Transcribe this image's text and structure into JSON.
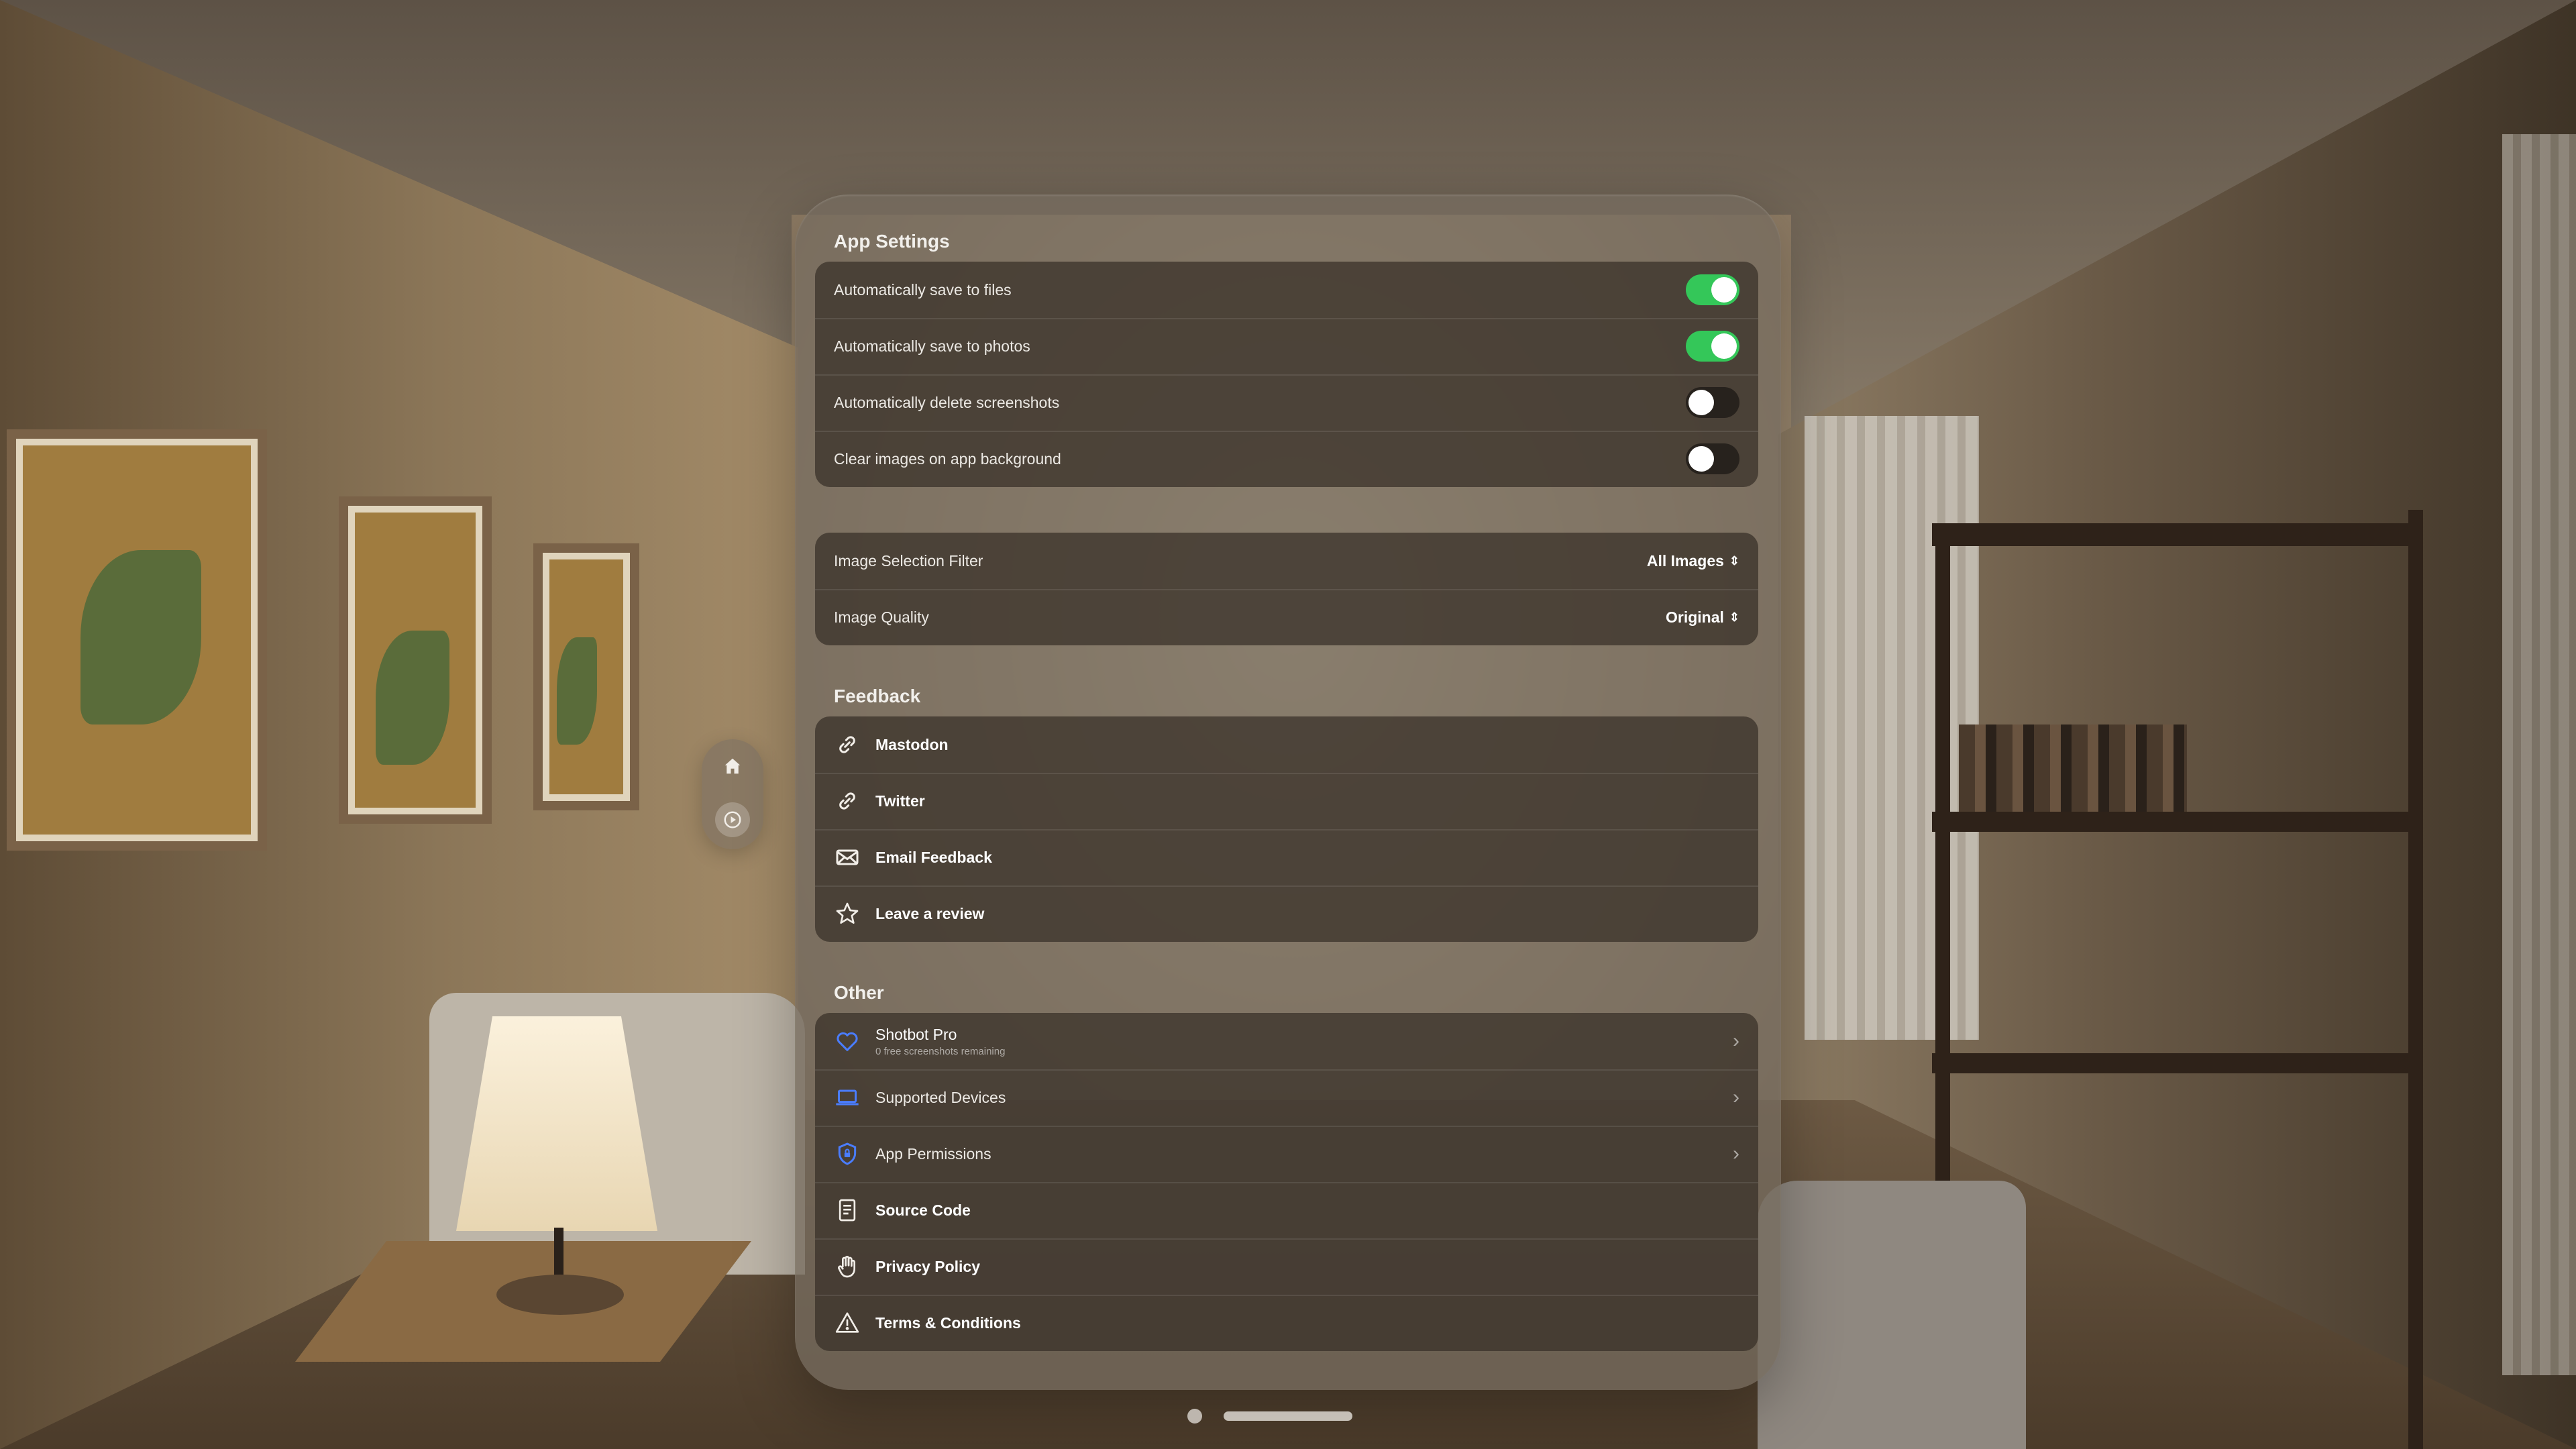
{
  "app_settings": {
    "title": "App Settings",
    "toggles": [
      {
        "label": "Automatically save to files",
        "on": true
      },
      {
        "label": "Automatically save to photos",
        "on": true
      },
      {
        "label": "Automatically delete screenshots",
        "on": false
      },
      {
        "label": "Clear images on app background",
        "on": false
      }
    ],
    "pickers": [
      {
        "label": "Image Selection Filter",
        "value": "All Images"
      },
      {
        "label": "Image Quality",
        "value": "Original"
      }
    ]
  },
  "feedback": {
    "title": "Feedback",
    "items": [
      {
        "label": "Mastodon",
        "icon": "link-icon"
      },
      {
        "label": "Twitter",
        "icon": "link-icon"
      },
      {
        "label": "Email Feedback",
        "icon": "envelope-icon"
      },
      {
        "label": "Leave a review",
        "icon": "star-icon"
      }
    ]
  },
  "other": {
    "title": "Other",
    "items": [
      {
        "label": "Shotbot Pro",
        "subtitle": "0 free screenshots remaining",
        "icon": "heart-icon",
        "chevron": true
      },
      {
        "label": "Supported Devices",
        "icon": "laptop-icon",
        "chevron": true
      },
      {
        "label": "App Permissions",
        "icon": "shield-icon",
        "chevron": true
      },
      {
        "label": "Source Code",
        "icon": "document-icon",
        "chevron": false
      },
      {
        "label": "Privacy Policy",
        "icon": "hand-icon",
        "chevron": false
      },
      {
        "label": "Terms & Conditions",
        "icon": "warning-icon",
        "chevron": false
      }
    ]
  },
  "ornament": {
    "items": [
      {
        "icon": "house-icon"
      },
      {
        "icon": "play-circle-icon"
      }
    ]
  },
  "colors": {
    "toggle_on": "#34c759",
    "accent_blue": "#4a7dff"
  },
  "chevron_glyph": "›",
  "updown_glyph": "⇕"
}
